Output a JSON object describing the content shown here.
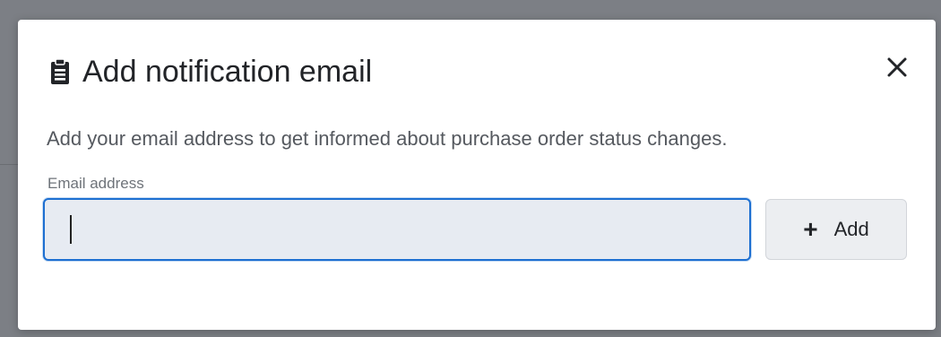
{
  "dialog": {
    "title": "Add notification email",
    "header_icon": "clipboard-icon",
    "close_icon": "close-icon",
    "description": "Add your email address to get informed about purchase order status changes.",
    "email_field": {
      "label": "Email address",
      "value": "",
      "placeholder": ""
    },
    "add_button": {
      "icon": "plus-icon",
      "icon_glyph": "+",
      "label": "Add"
    }
  },
  "colors": {
    "accent": "#1d6fd1",
    "input_background": "#e7ebf2",
    "overlay": "#7c7f85"
  }
}
